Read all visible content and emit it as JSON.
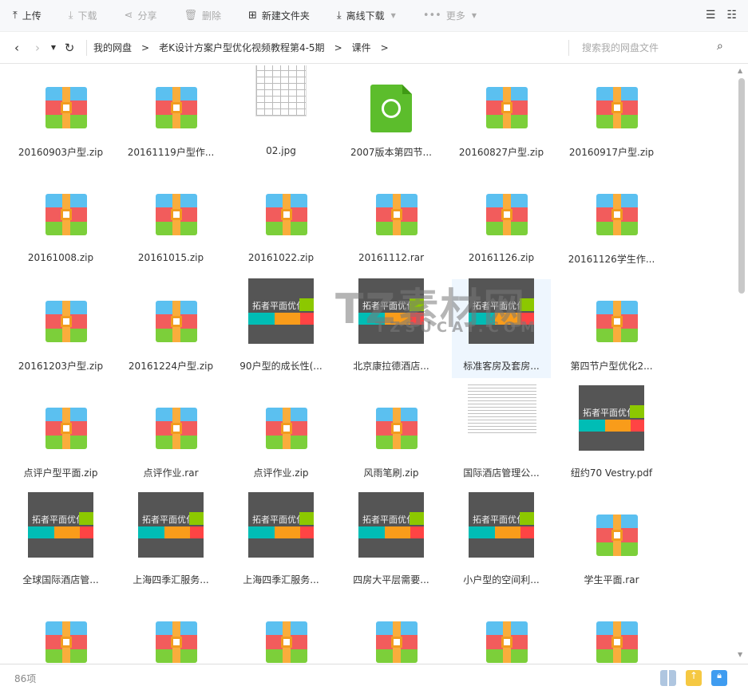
{
  "toolbar": {
    "upload": "上传",
    "download": "下载",
    "share": "分享",
    "delete": "删除",
    "new_folder": "新建文件夹",
    "offline_download": "离线下载",
    "more": "更多"
  },
  "nav": {
    "breadcrumb": [
      "我的网盘",
      "老K设计方案户型优化视频教程第4-5期",
      "课件"
    ],
    "search_placeholder": "搜索我的网盘文件"
  },
  "thumb_text": "拓者平面优化",
  "watermark": {
    "main": "TZ素材网",
    "sub": "TZSUCAI.COM"
  },
  "files": [
    {
      "name": "20160903户型.zip",
      "type": "zip"
    },
    {
      "name": "20161119户型作...",
      "type": "zip"
    },
    {
      "name": "02.jpg",
      "type": "jpg"
    },
    {
      "name": "2007版本第四节...",
      "type": "app"
    },
    {
      "name": "20160827户型.zip",
      "type": "zip"
    },
    {
      "name": "20160917户型.zip",
      "type": "zip"
    },
    {
      "name": "20161008.zip",
      "type": "zip"
    },
    {
      "name": "20161015.zip",
      "type": "zip"
    },
    {
      "name": "20161022.zip",
      "type": "zip"
    },
    {
      "name": "20161112.rar",
      "type": "zip"
    },
    {
      "name": "20161126.zip",
      "type": "zip"
    },
    {
      "name": "20161126学生作...",
      "type": "zip"
    },
    {
      "name": "20161203户型.zip",
      "type": "zip"
    },
    {
      "name": "20161224户型.zip",
      "type": "zip"
    },
    {
      "name": "90户型的成长性(...",
      "type": "thumb"
    },
    {
      "name": "北京康拉德酒店...",
      "type": "thumb"
    },
    {
      "name": "标准客房及套房...",
      "type": "thumb",
      "selected": true
    },
    {
      "name": "第四节户型优化2...",
      "type": "zip"
    },
    {
      "name": "点评户型平面.zip",
      "type": "zip"
    },
    {
      "name": "点评作业.rar",
      "type": "zip"
    },
    {
      "name": "点评作业.zip",
      "type": "zip"
    },
    {
      "name": "风雨笔刷.zip",
      "type": "zip"
    },
    {
      "name": "国际酒店管理公...",
      "type": "doc"
    },
    {
      "name": "纽约70 Vestry.pdf",
      "type": "thumb"
    },
    {
      "name": "全球国际酒店管...",
      "type": "thumb"
    },
    {
      "name": "上海四季汇服务...",
      "type": "thumb"
    },
    {
      "name": "上海四季汇服务...",
      "type": "thumb"
    },
    {
      "name": "四房大平层需要...",
      "type": "thumb"
    },
    {
      "name": "小户型的空间利...",
      "type": "thumb"
    },
    {
      "name": "学生平面.rar",
      "type": "zip"
    },
    {
      "name": "",
      "type": "zip"
    },
    {
      "name": "",
      "type": "zip"
    },
    {
      "name": "",
      "type": "zip"
    },
    {
      "name": "",
      "type": "zip"
    },
    {
      "name": "",
      "type": "zip"
    },
    {
      "name": "",
      "type": "zip"
    }
  ],
  "status": {
    "count": "86项"
  }
}
